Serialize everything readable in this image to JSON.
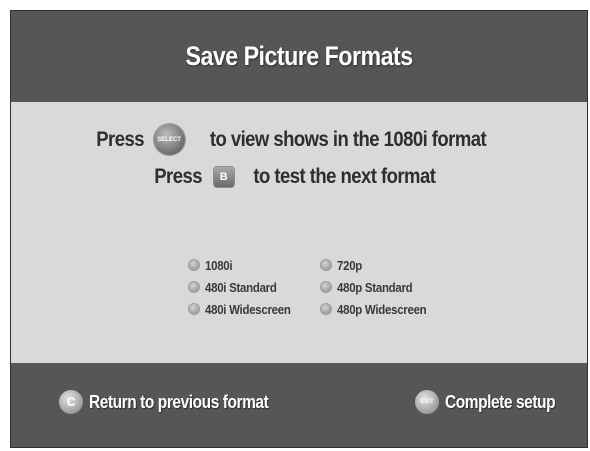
{
  "header": {
    "title": "Save Picture Formats"
  },
  "instructions": {
    "line1": {
      "prefix": "Press",
      "button_label": "SELECT",
      "suffix": "to view shows in the 1080i format"
    },
    "line2": {
      "prefix": "Press",
      "button_label": "B",
      "suffix": "to test the next format"
    }
  },
  "options": {
    "left": [
      {
        "label": "1080i"
      },
      {
        "label": "480i Standard"
      },
      {
        "label": "480i Widescreen"
      }
    ],
    "right": [
      {
        "label": "720p"
      },
      {
        "label": "480p Standard"
      },
      {
        "label": "480p Widescreen"
      }
    ]
  },
  "footer": {
    "back": {
      "icon_letter": "C",
      "label": "Return to previous format"
    },
    "complete": {
      "icon_letter": "EXIT",
      "label": "Complete setup"
    }
  },
  "colors": {
    "header_bg": "#565656",
    "content_bg": "#d9d9d9",
    "text_dark": "#2e2e2e",
    "text_light": "#ffffff"
  }
}
